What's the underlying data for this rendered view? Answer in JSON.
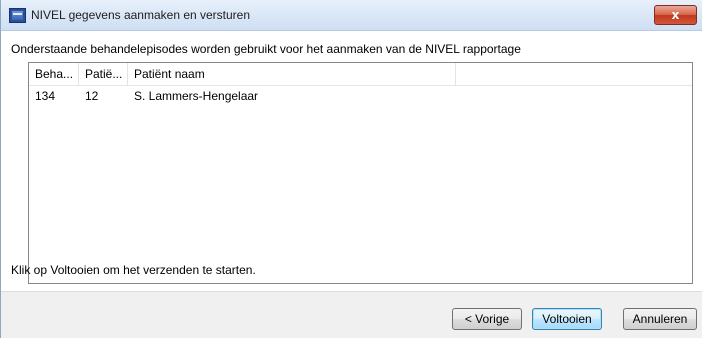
{
  "window": {
    "title": "NIVEL gegevens aanmaken en versturen",
    "close_label": "x"
  },
  "intro_text": "Onderstaande behandelepisodes worden gebruikt voor het aanmaken van de NIVEL rapportage",
  "table": {
    "columns": [
      "Beha...",
      "Patië...",
      "Patiënt naam",
      ""
    ],
    "rows": [
      [
        "134",
        "12",
        "S. Lammers-Hengelaar"
      ]
    ]
  },
  "hint_text": "Klik op Voltooien om het verzenden te starten.",
  "buttons": {
    "previous": "< Vorige",
    "finish": "Voltooien",
    "cancel": "Annuleren"
  },
  "colors": {
    "title_bar": "#dbe8f7",
    "close_button": "#c2381a",
    "default_button_border": "#3c7fb1"
  },
  "icons": {
    "app": "app-icon",
    "close": "close-icon"
  }
}
